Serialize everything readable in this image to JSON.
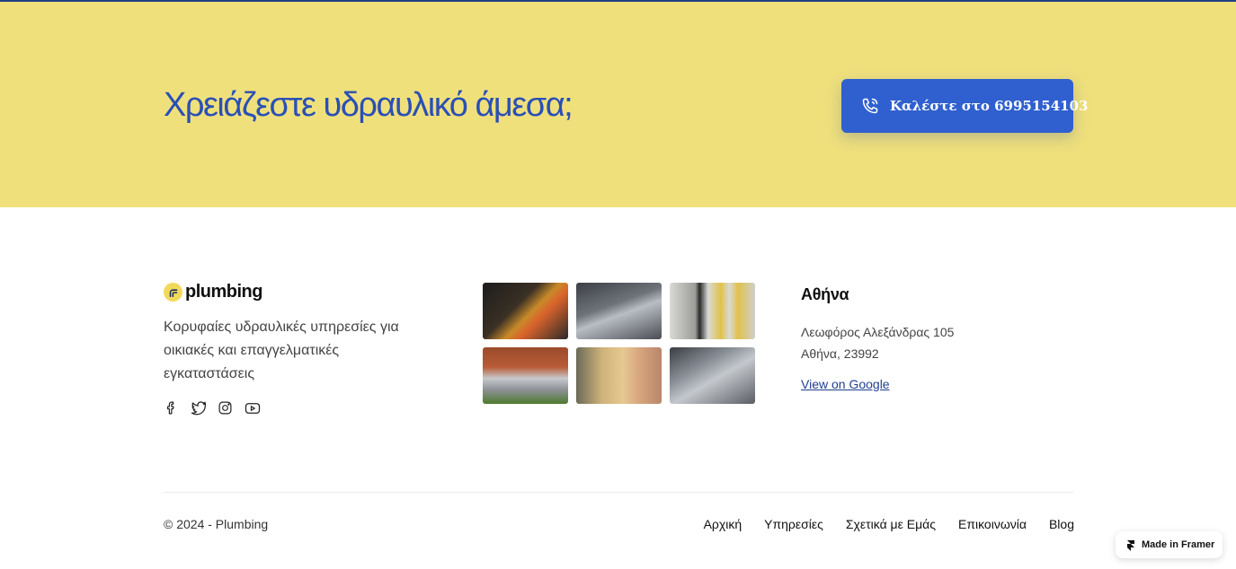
{
  "cta": {
    "title": "Χρειάζεστε υδραυλικό άμεσα;",
    "button_label": "Καλέστε στο 6995154103",
    "button_icon": "phone-icon",
    "background": "#efe07c",
    "accent": "#3060cf"
  },
  "brand": {
    "name": "plumbing",
    "tagline": "Κορυφαίες υδραυλικές υπηρεσίες για οικιακές και επαγγελματικές εγκαταστάσεις"
  },
  "socials": [
    "facebook-icon",
    "twitter-icon",
    "instagram-icon",
    "youtube-icon"
  ],
  "gallery": [
    "copper-valve",
    "chrome-faucet",
    "black-yellow-pipes",
    "building-ducts",
    "wall-pipe",
    "industrial-pipes"
  ],
  "location": {
    "city": "Αθήνα",
    "street": "Λεωφόρος Αλεξάνδρας 105",
    "city_zip": "Αθήνα, 23992",
    "map_link": "View on Google"
  },
  "footer": {
    "copyright": "© 2024 - Plumbing",
    "nav": [
      "Αρχική",
      "Υπηρεσίες",
      "Σχετικά με Εμάς",
      "Επικοινωνία",
      "Blog"
    ]
  },
  "badge": {
    "label": "Made in Framer"
  }
}
